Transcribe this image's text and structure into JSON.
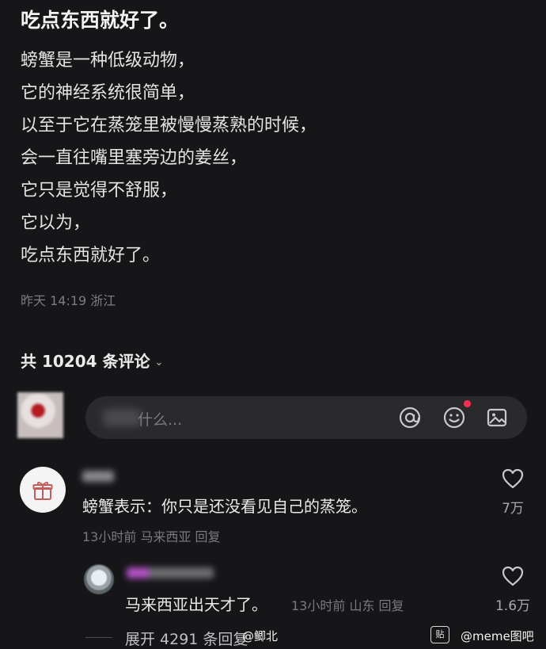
{
  "post": {
    "title": "吃点东西就好了。",
    "lines": [
      "螃蟹是一种低级动物，",
      "它的神经系统很简单，",
      "以至于它在蒸笼里被慢慢蒸熟的时候，",
      "会一直往嘴里塞旁边的姜丝，",
      "它只是觉得不舒服，",
      "它以为，",
      "吃点东西就好了。"
    ],
    "meta": "昨天 14:19 浙江"
  },
  "comments_header": {
    "label": "共 10204 条评论",
    "chevron_icon": "chevron-down-icon"
  },
  "composer": {
    "placeholder": "什么...",
    "icons": [
      "at-icon",
      "emoji-icon",
      "image-icon"
    ],
    "notification_color": "#ff2c55"
  },
  "comments": [
    {
      "avatar_icon": "gift-icon",
      "text": "螃蟹表示：你只是还没看见自己的蒸笼。",
      "meta": "13小时前 马来西亚 回复",
      "likes": "7万"
    },
    {
      "text": "马来西亚出天才了。",
      "meta": "13小时前 山东 回复",
      "likes": "1.6万"
    }
  ],
  "expand": {
    "label": "展开 4291 条回复"
  },
  "watermarks": {
    "left": "@鲫北",
    "right_box": "贴",
    "right": "@meme图吧"
  }
}
